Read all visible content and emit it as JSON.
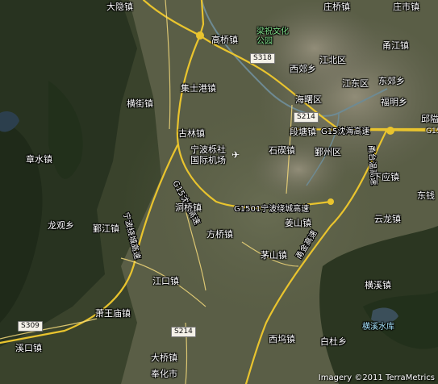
{
  "places": {
    "dayin": "大隐镇",
    "gaoqiao": "高桥镇",
    "jishigang": "集士港镇",
    "hengjie": "横街镇",
    "gulin": "古林镇",
    "airport": "宁波栎社\n国际机场",
    "zhangshui": "章水镇",
    "dongqiao": "洞桥镇",
    "longguan": "龙观乡",
    "yinjiang": "鄞江镇",
    "fangqiao": "方桥镇",
    "maoshan": "茅山镇",
    "jiangkou": "江口镇",
    "xiaowangmiao": "萧王庙镇",
    "xikou": "溪口镇",
    "daqiao": "大桥镇",
    "fenghua": "奉化市",
    "xiwu": "西坞镇",
    "baidu": "白杜乡",
    "hengxi": "横溪镇",
    "hengxi_reservoir": "横溪水库",
    "yunlong": "云龙镇",
    "dongqian": "东钱",
    "xiaying": "下应镇",
    "jiangshan": "姜山镇",
    "shiqi": "石碶镇",
    "yinzhou": "鄞州区",
    "duantang": "段塘镇",
    "haishu": "海曙区",
    "jiangdong": "江东区",
    "jiangbei": "江北区",
    "xijiao": "西郊乡",
    "dongjiao": "东郊乡",
    "fuming": "福明乡",
    "yongjiang": "甬江镇",
    "zhuangqiao": "庄桥镇",
    "zhuangshi": "庄市镇",
    "qiu": "邱隘"
  },
  "park": "梁祝文化\n公园",
  "shields": {
    "s318": "S318",
    "s214_top": "S214",
    "s214_bottom": "S214",
    "s309": "S309",
    "g15": "G15"
  },
  "highway_names": {
    "g15_east": "G15沈海高速",
    "g1501": "G1501宁波绕城高速",
    "g15_sw": "G15沈海高速",
    "yongtai": "甬台温高速",
    "ningbo_w": "宁波绕城高速",
    "yongjin": "甬金高速"
  },
  "credit": "Imagery ©2011 TerraMetrics",
  "colors": {
    "expressway": "#e9c42e",
    "road": "#f2d87a",
    "river": "#6e8a93",
    "label": "#ffffff"
  },
  "icons": {
    "airport": "airplane-icon"
  }
}
